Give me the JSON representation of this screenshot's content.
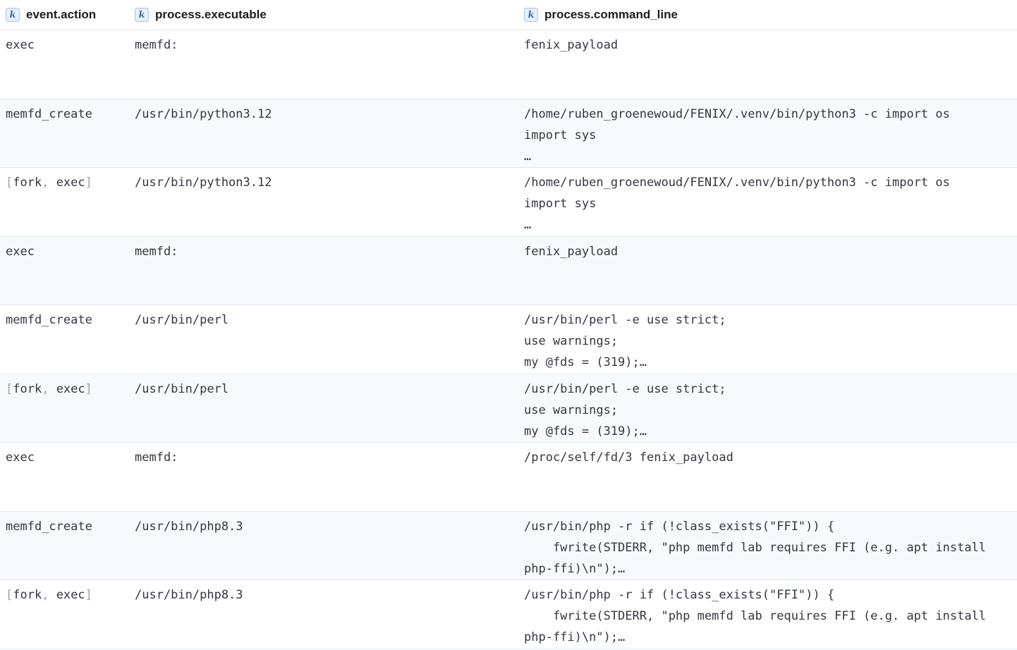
{
  "columns": [
    {
      "label": "event.action",
      "type_icon": "k"
    },
    {
      "label": "process.executable",
      "type_icon": "k"
    },
    {
      "label": "process.command_line",
      "type_icon": "k"
    }
  ],
  "rows": [
    {
      "action": "exec",
      "executable": "memfd:",
      "command": [
        "fenix_payload"
      ]
    },
    {
      "action": "memfd_create",
      "executable": "/usr/bin/python3.12",
      "command": [
        "/home/ruben_groenewoud/FENIX/.venv/bin/python3 -c import os",
        "import sys",
        "…"
      ]
    },
    {
      "action_array": [
        "fork",
        "exec"
      ],
      "executable": "/usr/bin/python3.12",
      "command": [
        "/home/ruben_groenewoud/FENIX/.venv/bin/python3 -c import os",
        "import sys",
        "…"
      ]
    },
    {
      "action": "exec",
      "executable": "memfd:",
      "command": [
        "fenix_payload"
      ]
    },
    {
      "action": "memfd_create",
      "executable": "/usr/bin/perl",
      "command": [
        "/usr/bin/perl -e use strict;",
        "use warnings;",
        "my @fds = (319);…"
      ]
    },
    {
      "action_array": [
        "fork",
        "exec"
      ],
      "executable": "/usr/bin/perl",
      "command": [
        "/usr/bin/perl -e use strict;",
        "use warnings;",
        "my @fds = (319);…"
      ]
    },
    {
      "action": "exec",
      "executable": "memfd:",
      "command": [
        "/proc/self/fd/3 fenix_payload"
      ]
    },
    {
      "action": "memfd_create",
      "executable": "/usr/bin/php8.3",
      "command": [
        "/usr/bin/php -r if (!class_exists(\"FFI\")) {",
        "    fwrite(STDERR, \"php memfd lab requires FFI (e.g. apt install",
        "php-ffi)\\n\");…"
      ]
    },
    {
      "action_array": [
        "fork",
        "exec"
      ],
      "executable": "/usr/bin/php8.3",
      "command": [
        "/usr/bin/php -r if (!class_exists(\"FFI\")) {",
        "    fwrite(STDERR, \"php memfd lab requires FFI (e.g. apt install",
        "php-ffi)\\n\");…"
      ]
    }
  ]
}
